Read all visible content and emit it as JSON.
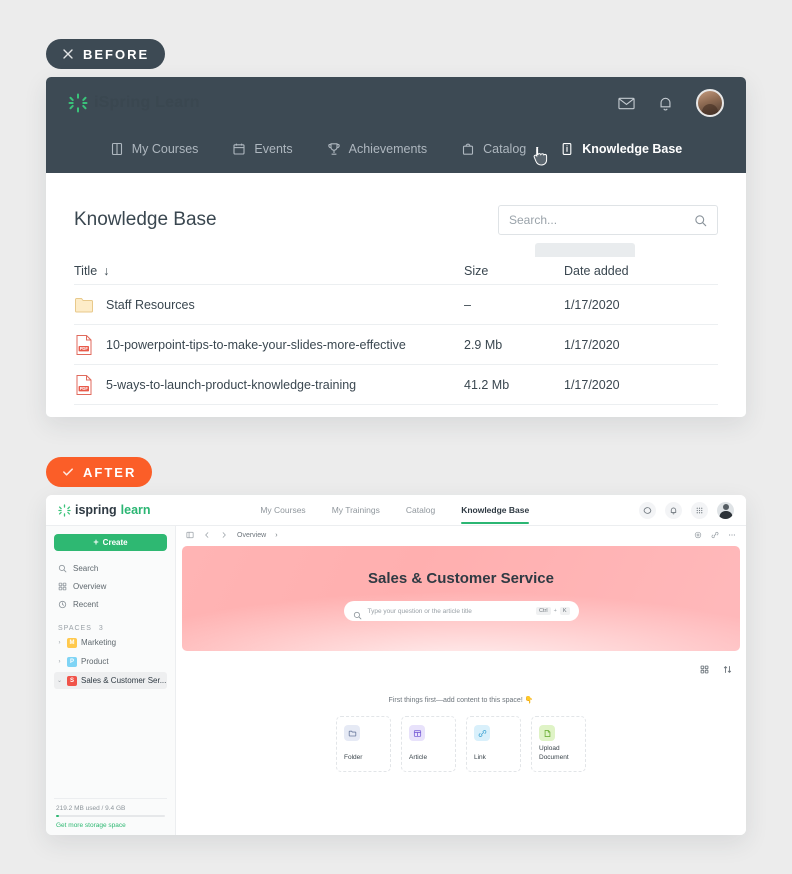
{
  "badges": {
    "before": {
      "label": "BEFORE",
      "icon": "close-icon",
      "color": "#3d4a54"
    },
    "after": {
      "label": "AFTER",
      "icon": "check-icon",
      "color": "#fb5e28"
    }
  },
  "before": {
    "logo": {
      "text": "iSpring Learn"
    },
    "topbar_icons": [
      "mail-icon",
      "bell-icon",
      "avatar"
    ],
    "tabs": [
      {
        "label": "My Courses",
        "icon": "book-icon",
        "active": false
      },
      {
        "label": "Events",
        "icon": "calendar-icon",
        "active": false
      },
      {
        "label": "Achievements",
        "icon": "trophy-icon",
        "active": false
      },
      {
        "label": "Catalog",
        "icon": "bag-icon",
        "active": false
      },
      {
        "label": "Knowledge Base",
        "icon": "info-doc-icon",
        "active": true
      }
    ],
    "page_title": "Knowledge Base",
    "search": {
      "placeholder": "Search...",
      "icon": "search-icon"
    },
    "table": {
      "columns": [
        "Title",
        "Size",
        "Date added"
      ],
      "sort_indicator": "↓",
      "rows": [
        {
          "icon": "folder-icon",
          "title": "Staff Resources",
          "size": "–",
          "date": "1/17/2020"
        },
        {
          "icon": "pdf-icon",
          "title": "10-powerpoint-tips-to-make-your-slides-more-effective",
          "size": "2.9 Mb",
          "date": "1/17/2020"
        },
        {
          "icon": "pdf-icon",
          "title": "5-ways-to-launch-product-knowledge-training",
          "size": "41.2 Mb",
          "date": "1/17/2020"
        }
      ]
    }
  },
  "after": {
    "logo": {
      "part1": "ispring",
      "part2": "learn"
    },
    "nav": [
      {
        "label": "My Courses",
        "active": false
      },
      {
        "label": "My Trainings",
        "active": false
      },
      {
        "label": "Catalog",
        "active": false
      },
      {
        "label": "Knowledge Base",
        "active": true
      }
    ],
    "topright_icons": [
      "chat-icon",
      "bell-icon",
      "apps-grid-icon",
      "avatar"
    ],
    "sidebar": {
      "create_label": "Create",
      "items": [
        {
          "label": "Search",
          "icon": "search-icon"
        },
        {
          "label": "Overview",
          "icon": "grid-icon"
        },
        {
          "label": "Recent",
          "icon": "clock-icon"
        }
      ],
      "spaces_header": "SPACES",
      "spaces_count": "3",
      "spaces": [
        {
          "label": "Marketing",
          "initial": "M",
          "color": "#ffc94d",
          "selected": false,
          "caret": "›"
        },
        {
          "label": "Product",
          "initial": "P",
          "color": "#7fd4f5",
          "selected": false,
          "caret": "›"
        },
        {
          "label": "Sales & Customer Ser...",
          "initial": "S",
          "color": "#f0544a",
          "selected": true,
          "caret": "⌄"
        }
      ],
      "storage_text": "219.2 MB used / 9.4 GB",
      "storage_link": "Get more storage space",
      "storage_percent": 2
    },
    "breadcrumb": {
      "panel_icon": "panel-toggle-icon",
      "back_icon": "chevron-left-icon",
      "forward_icon": "chevron-right-icon",
      "path": "Overview",
      "separator": "›",
      "right_icons": [
        "settings-icon",
        "link-icon",
        "more-icon"
      ]
    },
    "hero": {
      "title": "Sales & Customer Service",
      "search_placeholder": "Type your question or the article title",
      "shortcut_key1": "Ctrl",
      "shortcut_plus": "+",
      "shortcut_key2": "K",
      "bg_color": "#ffb2b2"
    },
    "toolbar_icons": [
      "grid-view-icon",
      "sort-icon"
    ],
    "empty_message": "First things first—add content to this space! 👇",
    "cards": [
      {
        "label": "Folder",
        "icon": "folder-icon",
        "bg": "#e6eaf5",
        "fg": "#6b7b9e"
      },
      {
        "label": "Article",
        "icon": "article-icon",
        "bg": "#e8e2fb",
        "fg": "#7c63d8"
      },
      {
        "label": "Link",
        "icon": "link-icon",
        "bg": "#d9f0fb",
        "fg": "#4aa9d6"
      },
      {
        "label": "Upload Document",
        "icon": "document-icon",
        "bg": "#dff3c6",
        "fg": "#72b33c"
      }
    ]
  }
}
